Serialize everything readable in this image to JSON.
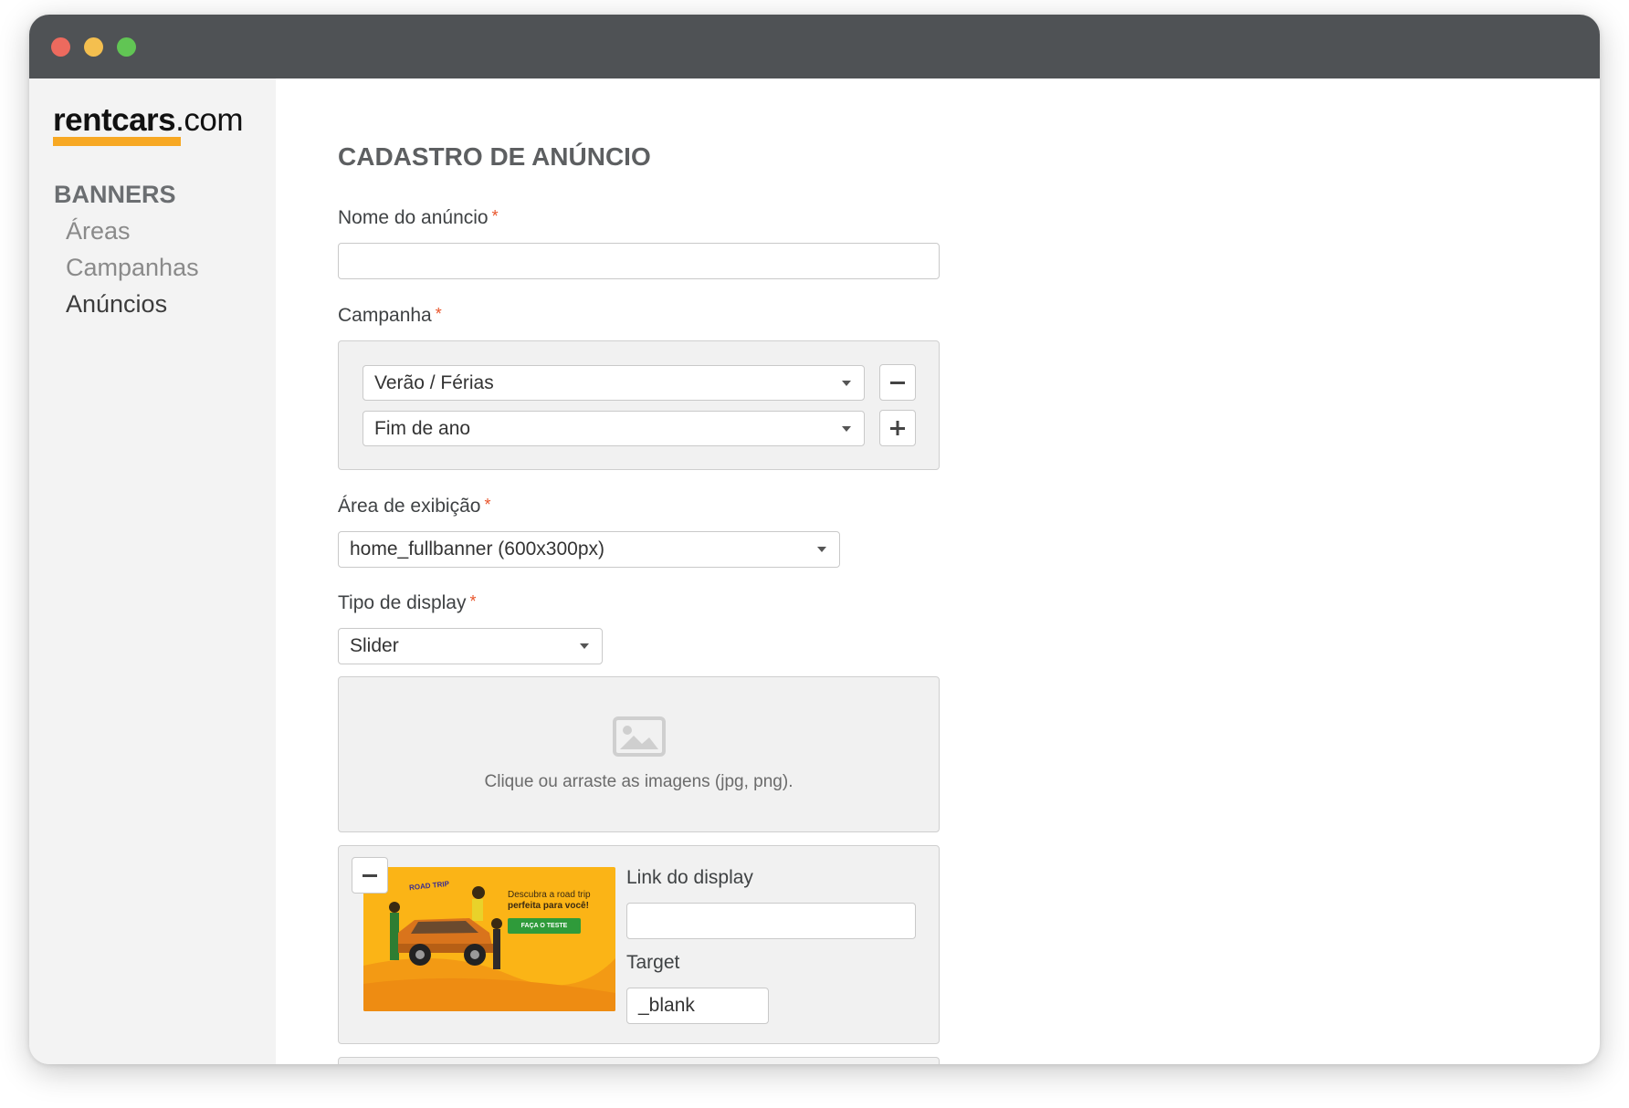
{
  "brand": {
    "logo_bold": "rentcars",
    "logo_regular": ".com",
    "accent_color": "#f7a823"
  },
  "sidebar": {
    "section_title": "BANNERS",
    "items": [
      {
        "label": "Áreas",
        "active": false
      },
      {
        "label": "Campanhas",
        "active": false
      },
      {
        "label": "Anúncios",
        "active": true
      }
    ]
  },
  "form": {
    "title": "CADASTRO DE ANÚNCIO",
    "required_mark": "*",
    "ad_name": {
      "label": "Nome do anúncio",
      "value": ""
    },
    "campaign": {
      "label": "Campanha",
      "selected": [
        {
          "value": "Verão / Férias",
          "action_icon": "minus-icon"
        },
        {
          "value": "Fim de ano",
          "action_icon": "plus-icon"
        }
      ]
    },
    "display_area": {
      "label": "Área de exibição",
      "value": "home_fullbanner (600x300px)"
    },
    "display_type": {
      "label": "Tipo de display",
      "value": "Slider"
    },
    "dropzone": {
      "icon": "image-icon",
      "text": "Clique ou arraste as imagens (jpg, png)."
    },
    "display_item": {
      "banner": {
        "brand": "ROAD TRIP",
        "headline_line1": "Descubra a road trip",
        "headline_line2": "perfeita para você!",
        "cta": "FAÇA O TESTE"
      },
      "link_label": "Link do display",
      "link_value": "",
      "target_label": "Target",
      "target_value": "_blank"
    }
  }
}
